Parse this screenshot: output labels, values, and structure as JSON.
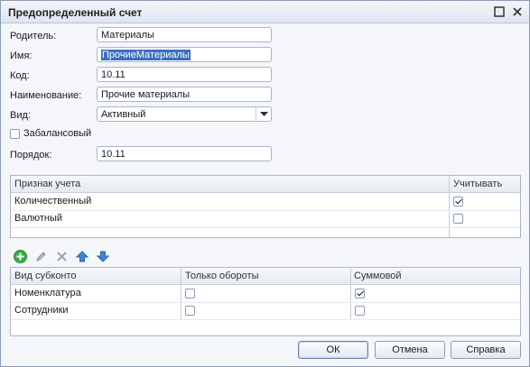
{
  "window": {
    "title": "Предопределенный счет"
  },
  "form": {
    "parent_label": "Родитель:",
    "parent_value": "Материалы",
    "name_label": "Имя:",
    "name_value": "ПрочиеМатериалы",
    "code_label": "Код:",
    "code_value": "10.11",
    "title_label": "Наименование:",
    "title_value": "Прочие материалы",
    "type_label": "Вид:",
    "type_value": "Активный",
    "offbalance_label": "Забалансовый",
    "offbalance_checked": false,
    "order_label": "Порядок:",
    "order_value": "10.11"
  },
  "accounting_table": {
    "columns": [
      "Признак учета",
      "Учитывать"
    ],
    "rows": [
      {
        "name": "Количественный",
        "checked": true
      },
      {
        "name": "Валютный",
        "checked": false
      }
    ]
  },
  "toolbar": {
    "icons": [
      "add-icon",
      "edit-icon",
      "delete-icon",
      "move-up-icon",
      "move-down-icon"
    ]
  },
  "subconto_table": {
    "columns": [
      "Вид субконто",
      "Только обороты",
      "Суммовой"
    ],
    "rows": [
      {
        "name": "Номенклатура",
        "turnover_only": false,
        "sum": true
      },
      {
        "name": "Сотрудники",
        "turnover_only": false,
        "sum": false
      }
    ]
  },
  "buttons": {
    "ok": "ОК",
    "cancel": "Отмена",
    "help": "Справка"
  },
  "colors": {
    "selection": "#3d6fbf",
    "add_green": "#3aa845",
    "arrow_blue": "#3c86d6",
    "delete_gray": "#9aa4b3"
  }
}
